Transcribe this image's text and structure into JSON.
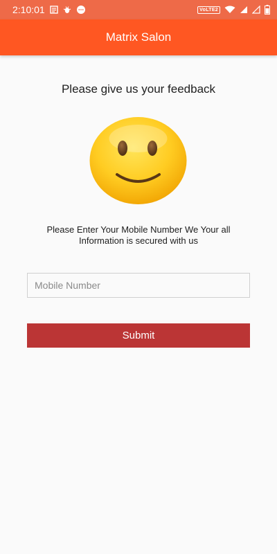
{
  "status_bar": {
    "time": "2:10:01",
    "volte_label": "VoLTE2",
    "icons": [
      "news-icon",
      "bug-icon",
      "chat-icon",
      "wifi-icon",
      "signal-icon",
      "battery-icon"
    ]
  },
  "app_bar": {
    "title": "Matrix Salon"
  },
  "main": {
    "heading": "Please give us your feedback",
    "emoji": "smiling-face-emoji",
    "info_text": "Please Enter Your Mobile Number We Your all Information is secured with us",
    "mobile_input": {
      "placeholder": "Mobile Number",
      "value": ""
    },
    "submit_label": "Submit"
  },
  "colors": {
    "status_bar": "#ee6a48",
    "app_bar": "#ff5722",
    "submit_button": "#bb3535",
    "background": "#fafafa"
  }
}
